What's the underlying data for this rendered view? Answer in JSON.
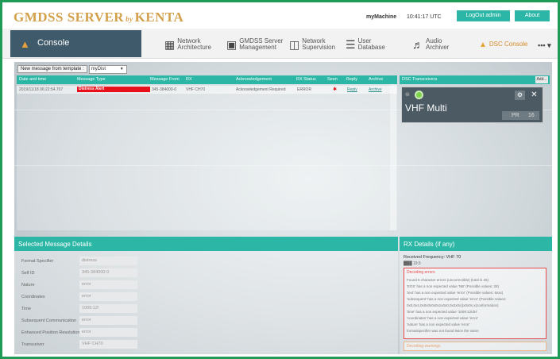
{
  "header": {
    "logo_main": "GMDSS SERVER",
    "logo_by": "by",
    "logo_brand": "KENTA",
    "machine": "myMachine",
    "clock": "10:41:17 UTC",
    "logout_label": "LogOut admin",
    "about_label": "About"
  },
  "nav": {
    "console_label": "Console",
    "items": [
      {
        "label": "Network Architecture",
        "icon": "network-architecture-icon"
      },
      {
        "label": "GMDSS Server Management",
        "icon": "server-management-icon"
      },
      {
        "label": "Network Supervision",
        "icon": "network-supervision-icon"
      },
      {
        "label": "User Database",
        "icon": "user-database-icon"
      },
      {
        "label": "Audio Archiver",
        "icon": "audio-archiver-icon"
      },
      {
        "label": "DSC Console",
        "icon": "dsc-console-icon"
      }
    ],
    "more_label": "▪▪▪ ▾"
  },
  "template": {
    "button_label": "New message from template :",
    "select_value": "myDist"
  },
  "messages": {
    "columns": [
      "Date and time",
      "Message Type",
      "Message From",
      "RX",
      "Acknowledgement",
      "RX Status",
      "Seen",
      "Reply",
      "Archive"
    ],
    "rows": [
      {
        "datetime": "2019/11/18 06:22:54.707",
        "type": "Distress Alert",
        "from": "345-384000-0",
        "rx": "VHF CH70",
        "ack": "Acknowledgement Required",
        "rx_status": "ERROR",
        "reply": "Reply",
        "archive": "Archive"
      }
    ]
  },
  "transceivers": {
    "title": "DSC Transceivers",
    "add_label": "Add...",
    "card": {
      "name": "VHF Multi",
      "pr_a": "PR",
      "pr_b": "16"
    }
  },
  "details": {
    "title": "Selected Message Details",
    "fields": [
      {
        "label": "Format Specifier",
        "value": "distress"
      },
      {
        "label": "Self ID",
        "value": "345-384000-0"
      },
      {
        "label": "Nature",
        "value": "error"
      },
      {
        "label": "Coordinates",
        "value": "error"
      },
      {
        "label": "Time",
        "value": "1009:12!"
      },
      {
        "label": "Subsequent Communication",
        "value": "error"
      },
      {
        "label": "Enhanced Position Resolution",
        "value": "error"
      },
      {
        "label": "Transceiver",
        "value": "VHF CH70"
      }
    ]
  },
  "rx": {
    "title": "RX Details (if any)",
    "freq_label": "Received Frequency:",
    "freq_value": "VHF 70",
    "sub": "███ 19.5",
    "errors_title": "Decoding errors",
    "errors": [
      "Found 6 character errors (uncorrectible) (total is 25)",
      "'EOS' has a non expected value 'NB' (Possible values: 28)",
      "'text' has a non expected value 'error' (Possible values: 6xxx)",
      "'subsequent' has a non expected value 'error' (Possible values:",
      "0x0,0x4,0x0x0x0x0x1x0x0,0x2x0x)(x0x0x.x(conformation)",
      "'time' has a non expected value '1009:12!dH'",
      "'coordinates' has a non expected value 'error'",
      "'nature' has a non expected value 'error'",
      "formatSpecifier was not found twice the same"
    ],
    "warnings_title": "Decoding warnings"
  },
  "colors": {
    "accent": "#2bb6a5",
    "frame": "#1f9a57",
    "nav_dark": "#3e5a6b",
    "distress": "#e8101b",
    "brand_gold": "#d3a14b"
  }
}
